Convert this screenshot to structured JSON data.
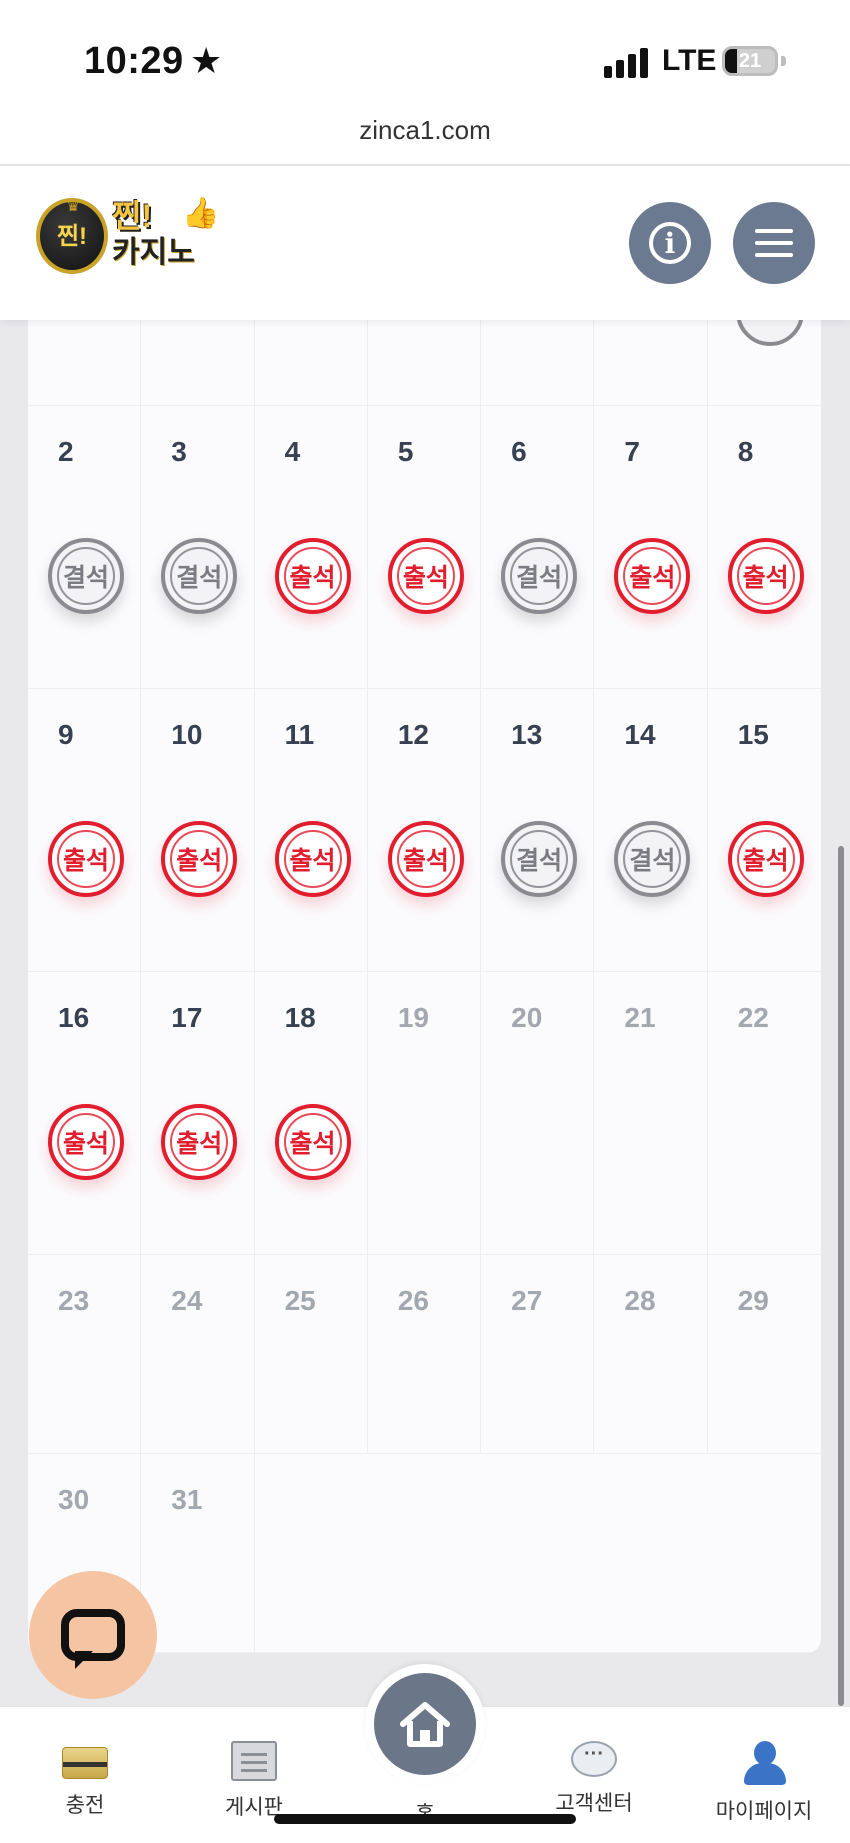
{
  "status_bar": {
    "time": "10:29",
    "carrier": "LTE",
    "battery": "21"
  },
  "browser": {
    "url": "zinca1.com"
  },
  "header": {
    "logo_title": "찐!",
    "logo_subtitle": "카지노",
    "logo_badge": "찐!",
    "info_icon": "info-icon",
    "menu_icon": "menu-icon"
  },
  "calendar": {
    "stamp_labels": {
      "attended": "출석",
      "absent": "결석"
    },
    "partial_top_row": {
      "last_cell_stamp": "absent"
    },
    "weeks": [
      [
        {
          "day": "2",
          "stamp": "absent"
        },
        {
          "day": "3",
          "stamp": "absent"
        },
        {
          "day": "4",
          "stamp": "attended"
        },
        {
          "day": "5",
          "stamp": "attended"
        },
        {
          "day": "6",
          "stamp": "absent"
        },
        {
          "day": "7",
          "stamp": "attended"
        },
        {
          "day": "8",
          "stamp": "attended"
        }
      ],
      [
        {
          "day": "9",
          "stamp": "attended"
        },
        {
          "day": "10",
          "stamp": "attended"
        },
        {
          "day": "11",
          "stamp": "attended"
        },
        {
          "day": "12",
          "stamp": "attended"
        },
        {
          "day": "13",
          "stamp": "absent"
        },
        {
          "day": "14",
          "stamp": "absent"
        },
        {
          "day": "15",
          "stamp": "attended"
        }
      ],
      [
        {
          "day": "16",
          "stamp": "attended"
        },
        {
          "day": "17",
          "stamp": "attended"
        },
        {
          "day": "18",
          "stamp": "attended"
        },
        {
          "day": "19",
          "stamp": null,
          "future": true
        },
        {
          "day": "20",
          "stamp": null,
          "future": true
        },
        {
          "day": "21",
          "stamp": null,
          "future": true
        },
        {
          "day": "22",
          "stamp": null,
          "future": true
        }
      ],
      [
        {
          "day": "23",
          "stamp": null,
          "future": true
        },
        {
          "day": "24",
          "stamp": null,
          "future": true
        },
        {
          "day": "25",
          "stamp": null,
          "future": true
        },
        {
          "day": "26",
          "stamp": null,
          "future": true
        },
        {
          "day": "27",
          "stamp": null,
          "future": true
        },
        {
          "day": "28",
          "stamp": null,
          "future": true
        },
        {
          "day": "29",
          "stamp": null,
          "future": true
        }
      ],
      [
        {
          "day": "30",
          "stamp": null,
          "future": true
        },
        {
          "day": "31",
          "stamp": null,
          "future": true
        }
      ]
    ],
    "colors": {
      "attended": "#e11d2e",
      "absent": "#8a8a90",
      "future_text": "#a3a7b0"
    }
  },
  "bottom_nav": {
    "items": [
      {
        "label": "충전",
        "icon": "credit-card-icon"
      },
      {
        "label": "게시판",
        "icon": "board-icon"
      },
      {
        "label": "홈",
        "icon": "home-icon"
      },
      {
        "label": "고객센터",
        "icon": "speech-bubble-icon"
      },
      {
        "label": "마이페이지",
        "icon": "user-icon"
      }
    ]
  },
  "chat_fab": {
    "icon": "chat-icon",
    "color": "#f5c4a3"
  }
}
